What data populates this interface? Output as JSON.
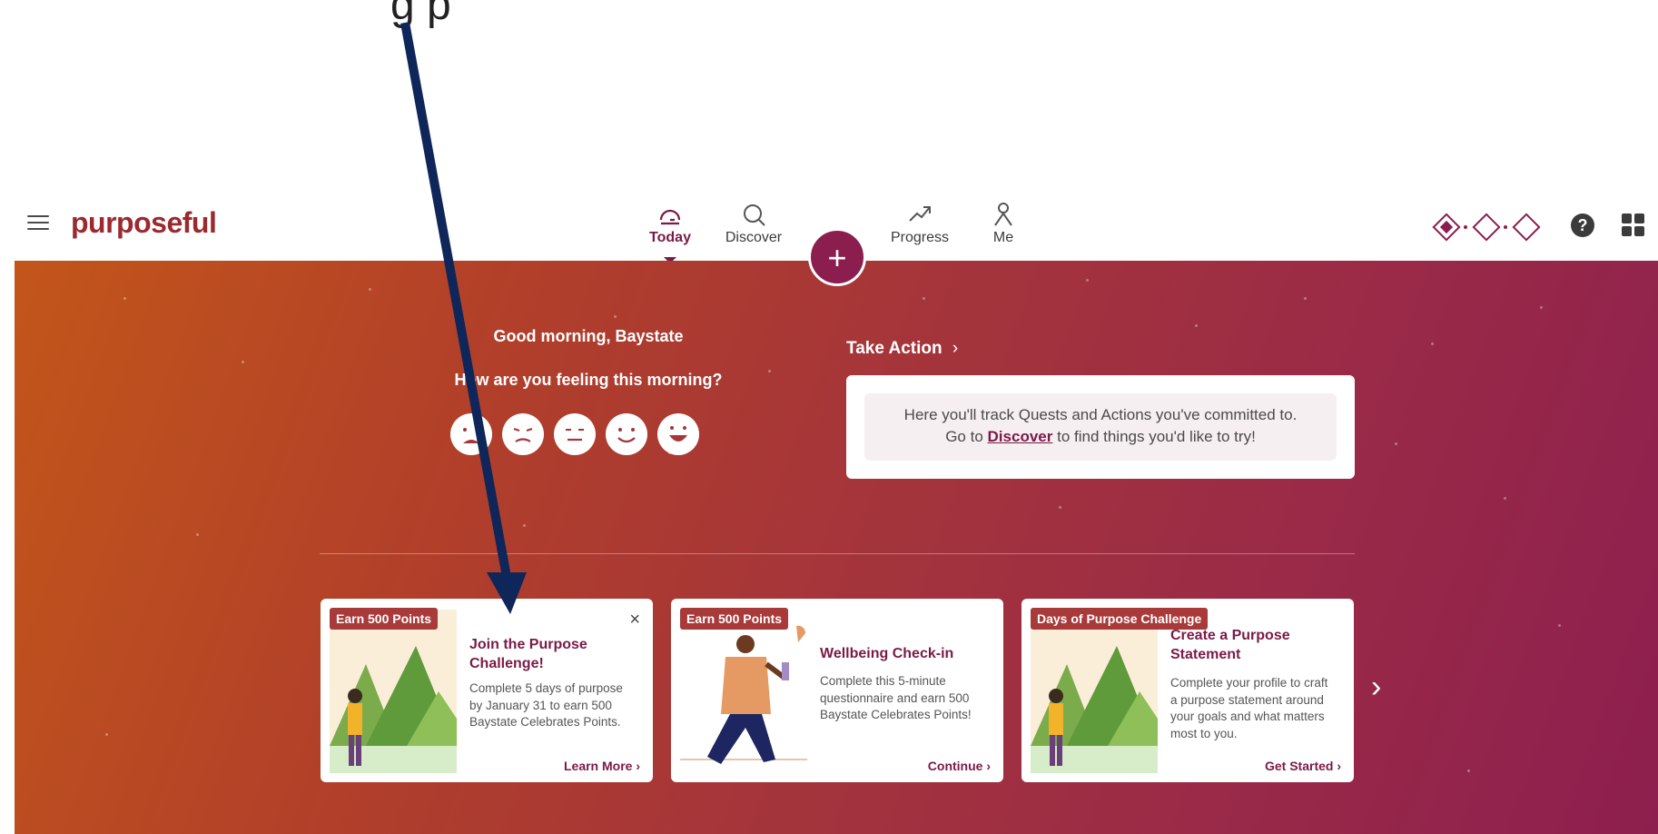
{
  "annotation": {
    "text": "g p"
  },
  "nav": {
    "logo": "purposeful",
    "items": [
      {
        "label": "Today",
        "icon": "dashboard-icon"
      },
      {
        "label": "Discover",
        "icon": "search-icon"
      },
      {
        "label": "Progress",
        "icon": "trend-icon"
      },
      {
        "label": "Me",
        "icon": "person-icon"
      }
    ],
    "plus": "+",
    "help": "?"
  },
  "hero": {
    "greeting": "Good morning, Baystate",
    "question": "How are you feeling this morning?",
    "take_action": "Take Action",
    "take_action_chevron": "›",
    "action_text_1": "Here you'll track Quests and Actions you've committed to.",
    "action_text_2a": "Go to",
    "action_link": "Discover",
    "action_text_2b": "to find things you'd like to try!"
  },
  "cards": [
    {
      "badge": "Earn 500 Points",
      "title": "Join the Purpose Challenge!",
      "desc": "Complete 5 days of purpose by January 31 to earn 500 Baystate Celebrates Points.",
      "cta": "Learn More ›",
      "close": "×"
    },
    {
      "badge": "Earn 500 Points",
      "title": "Wellbeing Check-in",
      "desc": "Complete this 5-minute questionnaire and earn 500 Baystate Celebrates Points!",
      "cta": "Continue ›"
    },
    {
      "badge": "Days of Purpose Challenge",
      "title": "Create a Purpose Statement",
      "desc": "Complete your profile to craft a purpose statement around your goals and what matters most to you.",
      "cta": "Get Started ›"
    }
  ],
  "next": "›",
  "colors": {
    "brand": "#8b1e4f",
    "accent": "#7a1a47"
  }
}
